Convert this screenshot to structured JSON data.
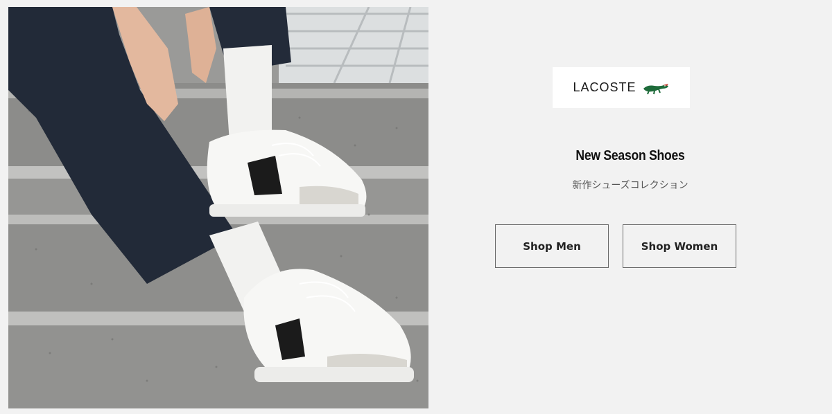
{
  "hero": {
    "image_description_icon": "sneakers-on-stairs-image"
  },
  "brand": {
    "logo_text": "LACOSTE",
    "logo_icon": "crocodile-icon",
    "accent_color": "#1e6b3a"
  },
  "promo": {
    "headline": "New Season Shoes",
    "subtitle": "新作シューズコレクション"
  },
  "buttons": {
    "shop_men": "Shop Men",
    "shop_women": "Shop Women"
  }
}
